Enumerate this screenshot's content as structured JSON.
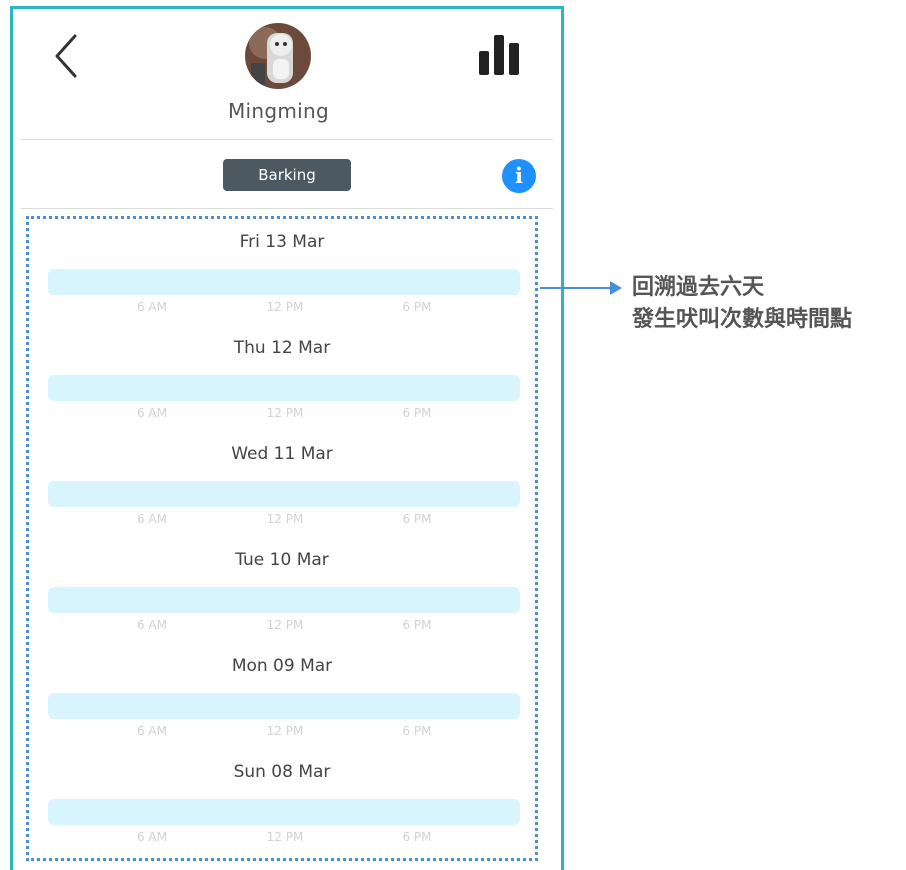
{
  "header": {
    "pet_name": "Mingming"
  },
  "filter": {
    "tag_label": "Barking",
    "info_glyph": "i"
  },
  "icons": {
    "back": "chevron-left-icon",
    "stats": "bar-chart-icon",
    "info": "info-icon"
  },
  "colors": {
    "frame": "#2bb6c2",
    "tag_bg": "#4c5963",
    "info_bg": "#1e90ff",
    "bar": "#d8f4fd",
    "annotation": "#4a8fd3"
  },
  "days": [
    {
      "label": "Fri 13 Mar",
      "ticks": [
        "6 AM",
        "12 PM",
        "6 PM"
      ]
    },
    {
      "label": "Thu 12 Mar",
      "ticks": [
        "6 AM",
        "12 PM",
        "6 PM"
      ]
    },
    {
      "label": "Wed 11 Mar",
      "ticks": [
        "6 AM",
        "12 PM",
        "6 PM"
      ]
    },
    {
      "label": "Tue 10 Mar",
      "ticks": [
        "6 AM",
        "12 PM",
        "6 PM"
      ]
    },
    {
      "label": "Mon 09 Mar",
      "ticks": [
        "6 AM",
        "12 PM",
        "6 PM"
      ]
    },
    {
      "label": "Sun 08 Mar",
      "ticks": [
        "6 AM",
        "12 PM",
        "6 PM"
      ]
    }
  ],
  "annotation": {
    "line1": "回溯過去六天",
    "line2": "發生吠叫次數與時間點"
  }
}
